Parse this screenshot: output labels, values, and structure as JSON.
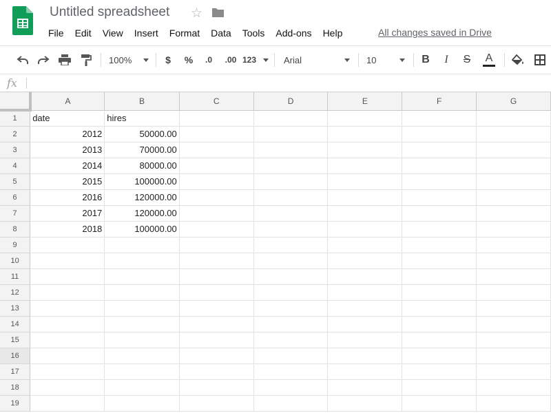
{
  "app": {
    "document_title": "Untitled spreadsheet",
    "saved_status": "All changes saved in Drive",
    "colors": {
      "sheets_green": "#0f9d58",
      "header_bg": "#f3f3f3",
      "grid_line": "#e2e2e2"
    }
  },
  "menu": {
    "items": [
      "File",
      "Edit",
      "View",
      "Insert",
      "Format",
      "Data",
      "Tools",
      "Add-ons",
      "Help"
    ]
  },
  "toolbar": {
    "undo_icon": "undo-icon",
    "redo_icon": "redo-icon",
    "print_icon": "print-icon",
    "paint_format_icon": "paint-format-icon",
    "zoom": "100%",
    "currency": "$",
    "percent": "%",
    "decrease_decimal": ".0",
    "increase_decimal": ".00",
    "more_formats": "123",
    "font": "Arial",
    "font_size": "10",
    "bold": "B",
    "italic": "I",
    "strikethrough": "S",
    "text_color": "A"
  },
  "formula_bar": {
    "fx_label": "fx",
    "value": ""
  },
  "sheet": {
    "columns": [
      "A",
      "B",
      "C",
      "D",
      "E",
      "F",
      "G"
    ],
    "rows": [
      {
        "n": "1",
        "cells": [
          "date",
          "hires",
          "",
          "",
          "",
          "",
          ""
        ]
      },
      {
        "n": "2",
        "cells": [
          "2012",
          "50000.00",
          "",
          "",
          "",
          "",
          ""
        ]
      },
      {
        "n": "3",
        "cells": [
          "2013",
          "70000.00",
          "",
          "",
          "",
          "",
          ""
        ]
      },
      {
        "n": "4",
        "cells": [
          "2014",
          "80000.00",
          "",
          "",
          "",
          "",
          ""
        ]
      },
      {
        "n": "5",
        "cells": [
          "2015",
          "100000.00",
          "",
          "",
          "",
          "",
          ""
        ]
      },
      {
        "n": "6",
        "cells": [
          "2016",
          "120000.00",
          "",
          "",
          "",
          "",
          ""
        ]
      },
      {
        "n": "7",
        "cells": [
          "2017",
          "120000.00",
          "",
          "",
          "",
          "",
          ""
        ]
      },
      {
        "n": "8",
        "cells": [
          "2018",
          "100000.00",
          "",
          "",
          "",
          "",
          ""
        ]
      },
      {
        "n": "9",
        "cells": [
          "",
          "",
          "",
          "",
          "",
          "",
          ""
        ]
      },
      {
        "n": "10",
        "cells": [
          "",
          "",
          "",
          "",
          "",
          "",
          ""
        ]
      },
      {
        "n": "11",
        "cells": [
          "",
          "",
          "",
          "",
          "",
          "",
          ""
        ]
      },
      {
        "n": "12",
        "cells": [
          "",
          "",
          "",
          "",
          "",
          "",
          ""
        ]
      },
      {
        "n": "13",
        "cells": [
          "",
          "",
          "",
          "",
          "",
          "",
          ""
        ]
      },
      {
        "n": "14",
        "cells": [
          "",
          "",
          "",
          "",
          "",
          "",
          ""
        ]
      },
      {
        "n": "15",
        "cells": [
          "",
          "",
          "",
          "",
          "",
          "",
          ""
        ]
      },
      {
        "n": "16",
        "cells": [
          "",
          "",
          "",
          "",
          "",
          "",
          ""
        ]
      },
      {
        "n": "17",
        "cells": [
          "",
          "",
          "",
          "",
          "",
          "",
          ""
        ]
      },
      {
        "n": "18",
        "cells": [
          "",
          "",
          "",
          "",
          "",
          "",
          ""
        ]
      },
      {
        "n": "19",
        "cells": [
          "",
          "",
          "",
          "",
          "",
          "",
          ""
        ]
      }
    ],
    "selected_row": "16"
  }
}
